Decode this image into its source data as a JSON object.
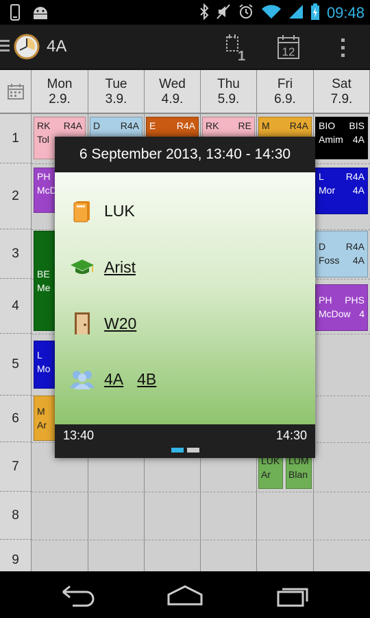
{
  "status_bar": {
    "time": "09:48"
  },
  "action_bar": {
    "title": "4A",
    "today_badge": "1",
    "calendar_day": "12"
  },
  "days": [
    {
      "name": "Mon",
      "date": "2.9."
    },
    {
      "name": "Tue",
      "date": "3.9."
    },
    {
      "name": "Wed",
      "date": "4.9."
    },
    {
      "name": "Thu",
      "date": "5.9."
    },
    {
      "name": "Fri",
      "date": "6.9."
    },
    {
      "name": "Sat",
      "date": "7.9."
    }
  ],
  "periods": [
    "1",
    "2",
    "3",
    "4",
    "5",
    "6",
    "7",
    "8",
    "9"
  ],
  "lessons": [
    {
      "subject": "RK",
      "room": "R4A",
      "teacher": "Tol",
      "cls": "",
      "color": "#f4b6c2",
      "text_color": "#222222"
    },
    {
      "subject": "D",
      "room": "R4A",
      "teacher": "",
      "cls": "",
      "color": "#a9cfe6",
      "text_color": "#222222"
    },
    {
      "subject": "E",
      "room": "R4A",
      "teacher": "",
      "cls": "",
      "color": "#c85a12",
      "text_color": "#ffffff"
    },
    {
      "subject": "RK",
      "room": "RE",
      "teacher": "",
      "cls": "",
      "color": "#f4b6c2",
      "text_color": "#222222"
    },
    {
      "subject": "M",
      "room": "R4A",
      "teacher": "",
      "cls": "",
      "color": "#e6a82e",
      "text_color": "#222222"
    },
    {
      "subject": "BIO",
      "room": "BIS",
      "teacher": "Amim",
      "cls": "4A",
      "color": "#000000",
      "text_color": "#ffffff"
    },
    {
      "subject": "PH",
      "room": "",
      "teacher": "McD",
      "cls": "",
      "color": "#9b44c8",
      "text_color": "#ffffff"
    },
    {
      "subject": "L",
      "room": "R4A",
      "teacher": "Mor",
      "cls": "4A",
      "color": "#1010c8",
      "text_color": "#ffffff"
    },
    {
      "subject": "BE",
      "room": "",
      "teacher": "Me",
      "cls": "",
      "color": "#0e6a12",
      "text_color": "#ffffff"
    },
    {
      "subject": "D",
      "room": "R4A",
      "teacher": "Foss",
      "cls": "4A",
      "color": "#a9cfe6",
      "text_color": "#222222"
    },
    {
      "subject": "PH",
      "room": "PHS",
      "teacher": "McDow",
      "cls": "4",
      "color": "#9b44c8",
      "text_color": "#ffffff"
    },
    {
      "subject": "L",
      "room": "",
      "teacher": "Mo",
      "cls": "",
      "color": "#1010c8",
      "text_color": "#ffffff"
    },
    {
      "subject": "M",
      "room": "",
      "teacher": "Ar",
      "cls": "",
      "color": "#e6a82e",
      "text_color": "#222222"
    },
    {
      "subject": "LUK",
      "room": "",
      "teacher": "Ar",
      "cls": "",
      "color": "#6fb056",
      "text_color": "#222222"
    },
    {
      "subject": "LUM",
      "room": "",
      "teacher": "Blan",
      "cls": "",
      "color": "#6fb056",
      "text_color": "#222222"
    }
  ],
  "popup": {
    "title": "6 September 2013, 13:40 - 14:30",
    "subject": "LUK",
    "teacher": "Arist",
    "room": "W20",
    "class_1": "4A",
    "class_2": "4B",
    "start_time": "13:40",
    "end_time": "14:30",
    "page_dot_active_color": "#33b5e5",
    "page_dot_inactive_color": "#cccccc"
  },
  "colors": {
    "accent": "#33b5e5"
  }
}
